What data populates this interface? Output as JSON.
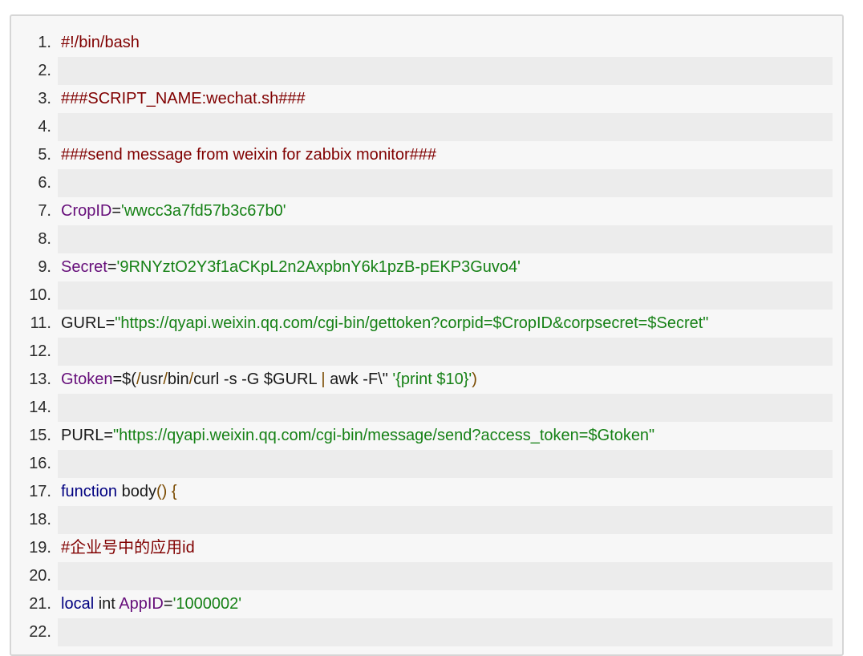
{
  "lines": [
    {
      "num": "1.",
      "parts": [
        {
          "t": "#!/bin/bash",
          "c": "comment"
        }
      ]
    },
    {
      "num": "2.",
      "parts": []
    },
    {
      "num": "3.",
      "parts": [
        {
          "t": "###SCRIPT_NAME:wechat.sh###",
          "c": "comment"
        }
      ]
    },
    {
      "num": "4.",
      "parts": []
    },
    {
      "num": "5.",
      "parts": [
        {
          "t": "###send message from weixin for zabbix monitor###",
          "c": "comment"
        }
      ]
    },
    {
      "num": "6.",
      "parts": []
    },
    {
      "num": "7.",
      "parts": [
        {
          "t": "CropID",
          "c": "var"
        },
        {
          "t": "=",
          "c": "plain"
        },
        {
          "t": "'wwcc3a7fd57b3c67b0'",
          "c": "str"
        }
      ]
    },
    {
      "num": "8.",
      "parts": []
    },
    {
      "num": "9.",
      "parts": [
        {
          "t": "Secret",
          "c": "var"
        },
        {
          "t": "=",
          "c": "plain"
        },
        {
          "t": "'9RNYztO2Y3f1aCKpL2n2AxpbnY6k1pzB-pEKP3Guvo4'",
          "c": "str"
        }
      ]
    },
    {
      "num": "10.",
      "parts": []
    },
    {
      "num": "11.",
      "parts": [
        {
          "t": "GURL=",
          "c": "plain"
        },
        {
          "t": "\"https://qyapi.weixin.qq.com/cgi-bin/gettoken?corpid=$CropID&corpsecret=$Secret\"",
          "c": "str"
        }
      ]
    },
    {
      "num": "12.",
      "parts": []
    },
    {
      "num": "13.",
      "parts": [
        {
          "t": "Gtoken",
          "c": "var"
        },
        {
          "t": "=$(",
          "c": "plain"
        },
        {
          "t": "/",
          "c": "punct"
        },
        {
          "t": "usr",
          "c": "plain"
        },
        {
          "t": "/",
          "c": "punct"
        },
        {
          "t": "bin",
          "c": "plain"
        },
        {
          "t": "/",
          "c": "punct"
        },
        {
          "t": "curl -s -G $GURL ",
          "c": "plain"
        },
        {
          "t": "|",
          "c": "punct"
        },
        {
          "t": " awk -F\\\" ",
          "c": "plain"
        },
        {
          "t": "'{print $10}'",
          "c": "str"
        },
        {
          "t": ")",
          "c": "punct"
        }
      ]
    },
    {
      "num": "14.",
      "parts": []
    },
    {
      "num": "15.",
      "parts": [
        {
          "t": "PURL=",
          "c": "plain"
        },
        {
          "t": "\"https://qyapi.weixin.qq.com/cgi-bin/message/send?access_token=$Gtoken\"",
          "c": "str"
        }
      ]
    },
    {
      "num": "16.",
      "parts": []
    },
    {
      "num": "17.",
      "parts": [
        {
          "t": "function",
          "c": "kw"
        },
        {
          "t": " body",
          "c": "plain"
        },
        {
          "t": "()",
          "c": "punct"
        },
        {
          "t": " ",
          "c": "plain"
        },
        {
          "t": "{",
          "c": "punct"
        }
      ]
    },
    {
      "num": "18.",
      "parts": []
    },
    {
      "num": "19.",
      "parts": [
        {
          "t": "#企业号中的应用id",
          "c": "comment"
        }
      ]
    },
    {
      "num": "20.",
      "parts": []
    },
    {
      "num": "21.",
      "parts": [
        {
          "t": "local",
          "c": "kw"
        },
        {
          "t": " int ",
          "c": "plain"
        },
        {
          "t": "AppID",
          "c": "var"
        },
        {
          "t": "=",
          "c": "plain"
        },
        {
          "t": "'1000002'",
          "c": "str"
        }
      ]
    },
    {
      "num": "22.",
      "parts": []
    }
  ]
}
